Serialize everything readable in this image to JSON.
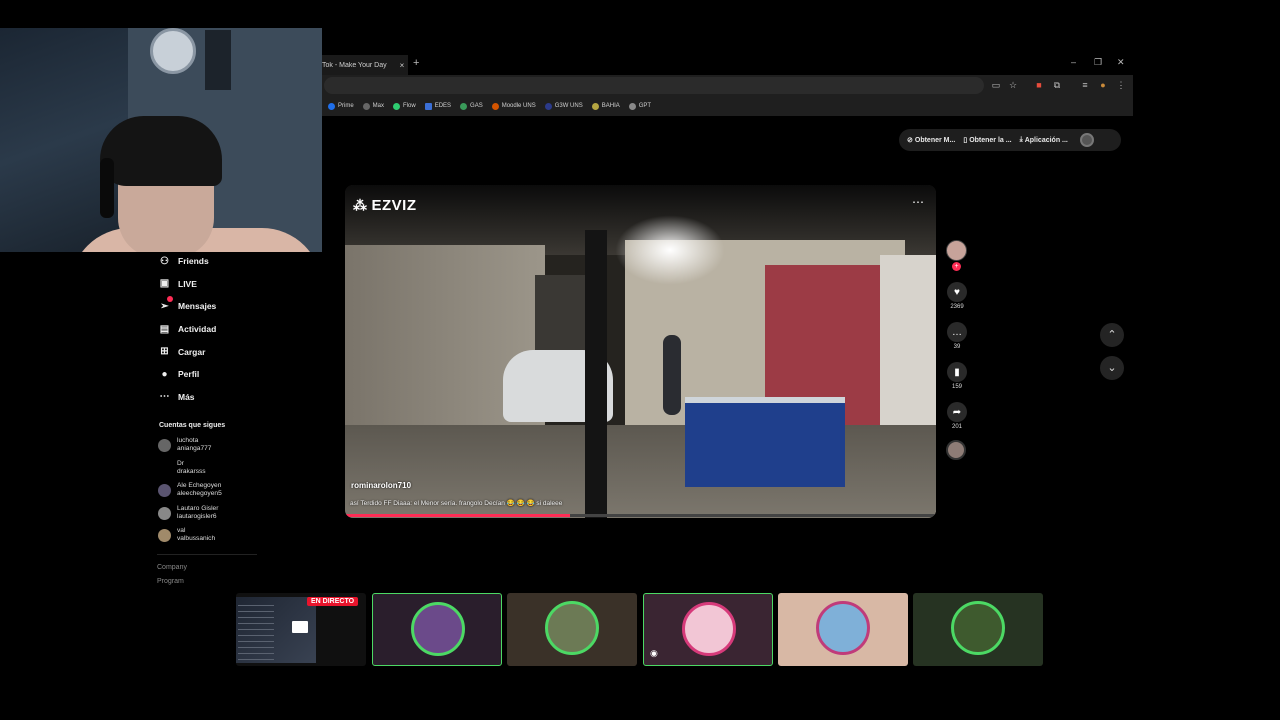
{
  "browser": {
    "tab_title": "Tok - Make Your Day",
    "tab_close": "×",
    "new_tab": "+",
    "window_controls": [
      "–",
      "❐",
      "✕"
    ],
    "bookmarks": [
      {
        "label": "Prime",
        "color": "#1f6feb"
      },
      {
        "label": "Max",
        "color": "#666666"
      },
      {
        "label": "Flow",
        "color": "#2ecc71"
      },
      {
        "label": "EDES",
        "color": "#3b6fd6"
      },
      {
        "label": "GAS",
        "color": "#3a9a5a"
      },
      {
        "label": "Moodle UNS",
        "color": "#d35400"
      },
      {
        "label": "G3W UNS",
        "color": "#2b3a8a"
      },
      {
        "label": "BAHIA",
        "color": "#b5a642"
      },
      {
        "label": "GPT",
        "color": "#888888"
      }
    ]
  },
  "top_pill": {
    "item1": "Obtener M...",
    "item2": "Obtener la ...",
    "item3": "Aplicación ..."
  },
  "sidebar": {
    "nav": [
      {
        "label": "Friends",
        "icon": "friends-icon"
      },
      {
        "label": "LIVE",
        "icon": "live-icon"
      },
      {
        "label": "Mensajes",
        "icon": "messages-icon"
      },
      {
        "label": "Actividad",
        "icon": "activity-icon"
      },
      {
        "label": "Cargar",
        "icon": "upload-icon"
      },
      {
        "label": "Perfil",
        "icon": "profile-icon"
      },
      {
        "label": "Más",
        "icon": "more-icon"
      }
    ],
    "following_title": "Cuentas que sigues",
    "accounts": [
      {
        "name": "luchota",
        "handle": "anianga777"
      },
      {
        "name": "Dr",
        "handle": "drakarsss"
      },
      {
        "name": "Ale Echegoyen",
        "handle": "aleechegoyen5"
      },
      {
        "name": "Lautaro Gisler",
        "handle": "lautarogisler6"
      },
      {
        "name": "val",
        "handle": "valbussanich"
      }
    ],
    "footer": [
      "Company",
      "Program"
    ]
  },
  "video": {
    "watermark": "EZVIZ",
    "author": "rominarolon710",
    "caption": "así Terdido FF Diaaa: el Menor sería. frangolo Decían 😂 😂 😂 si daleee",
    "progress": 0.38
  },
  "actions": {
    "likes": "2369",
    "comments": "39",
    "saves": "159",
    "shares": "201"
  },
  "stream_bar": {
    "live_badge": "EN DIRECTO"
  }
}
